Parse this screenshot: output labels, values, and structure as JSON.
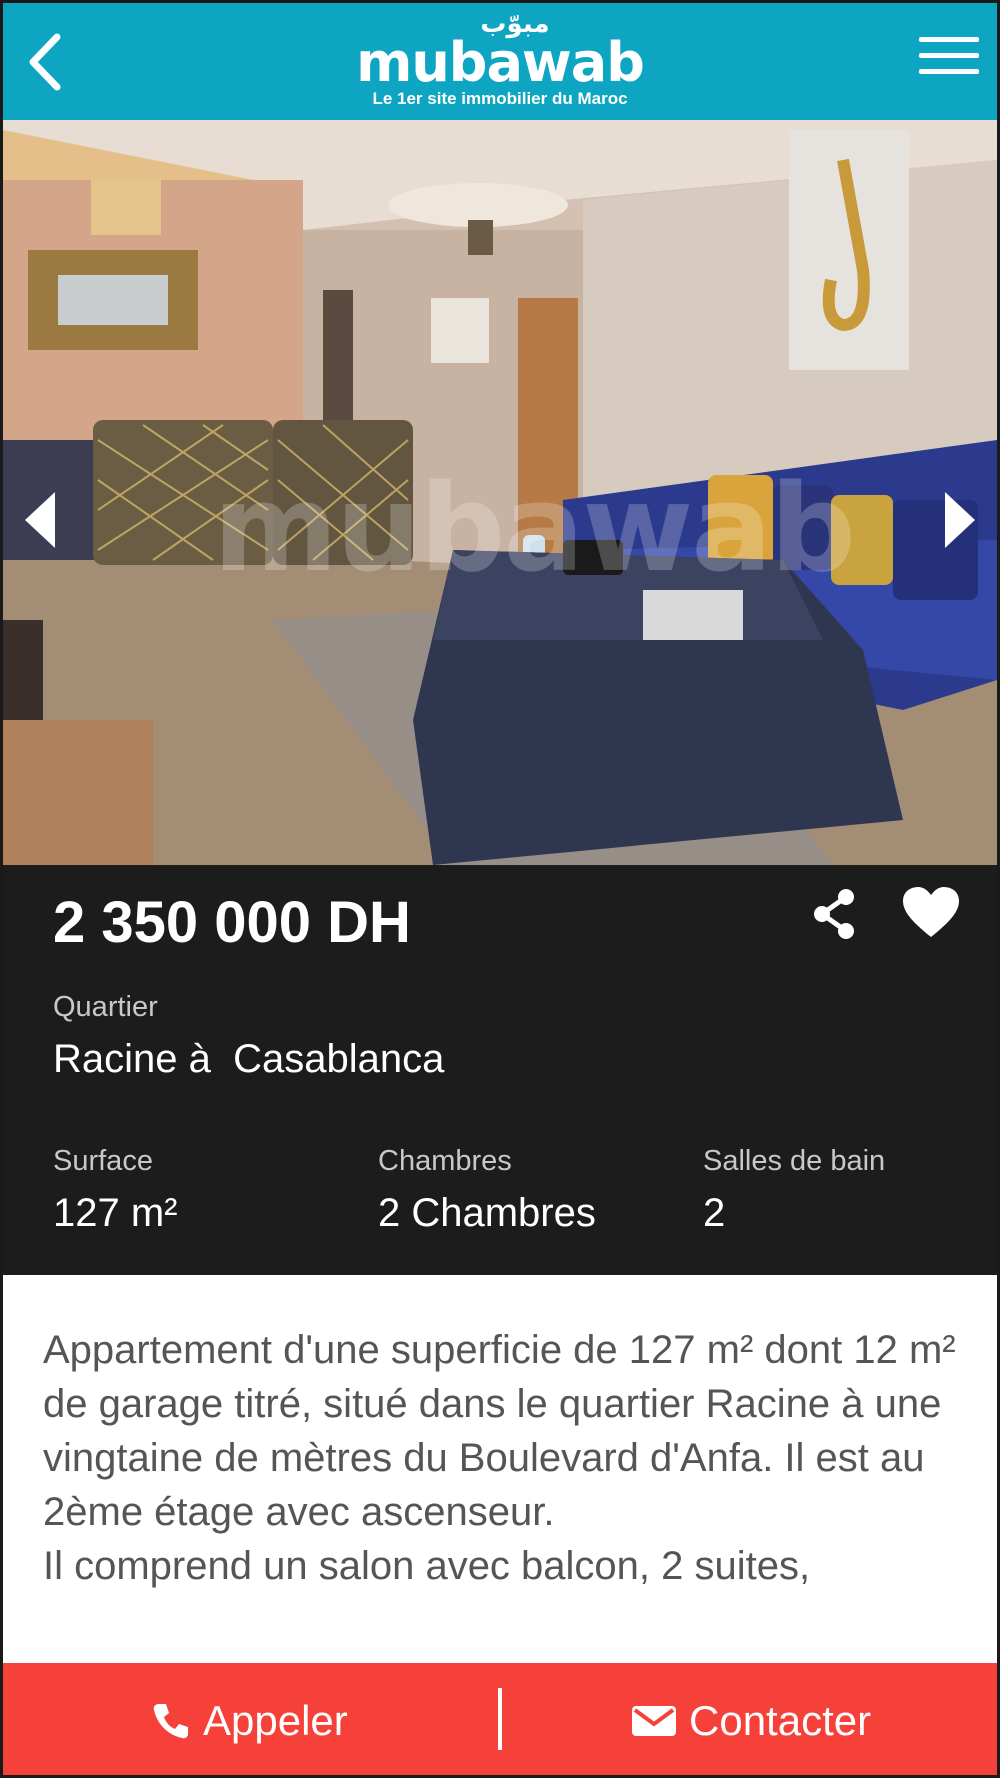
{
  "header": {
    "logo_arabic": "مبوّب",
    "logo_text": "mubawab",
    "tagline": "Le 1er site immobilier du Maroc",
    "color": "#0ea5c3",
    "back_icon": "chevron-left-icon",
    "menu_icon": "hamburger-menu-icon"
  },
  "gallery": {
    "watermark": "mubawab",
    "prev_icon": "triangle-left-icon",
    "next_icon": "triangle-right-icon"
  },
  "listing": {
    "price": "2 350 000 DH",
    "share_icon": "share-icon",
    "favorite_icon": "heart-icon",
    "quartier_label": "Quartier",
    "quartier_value": "Racine à  Casablanca",
    "surface_label": "Surface",
    "surface_value": "127 m²",
    "chambres_label": "Chambres",
    "chambres_value": "2 Chambres",
    "salles_label": "Salles de bain",
    "salles_value": "2"
  },
  "description": {
    "paragraph1": "Appartement d'une superficie de 127 m² dont 12 m² de garage titré, situé dans le quartier Racine à une vingtaine de mètres du Boulevard d'Anfa. Il est au 2ème étage avec ascenseur.",
    "paragraph2": "Il comprend un salon avec balcon, 2 suites,"
  },
  "actions": {
    "call_label": "Appeler",
    "call_icon": "phone-icon",
    "contact_label": "Contacter",
    "contact_icon": "envelope-icon",
    "color": "#f5413a"
  }
}
